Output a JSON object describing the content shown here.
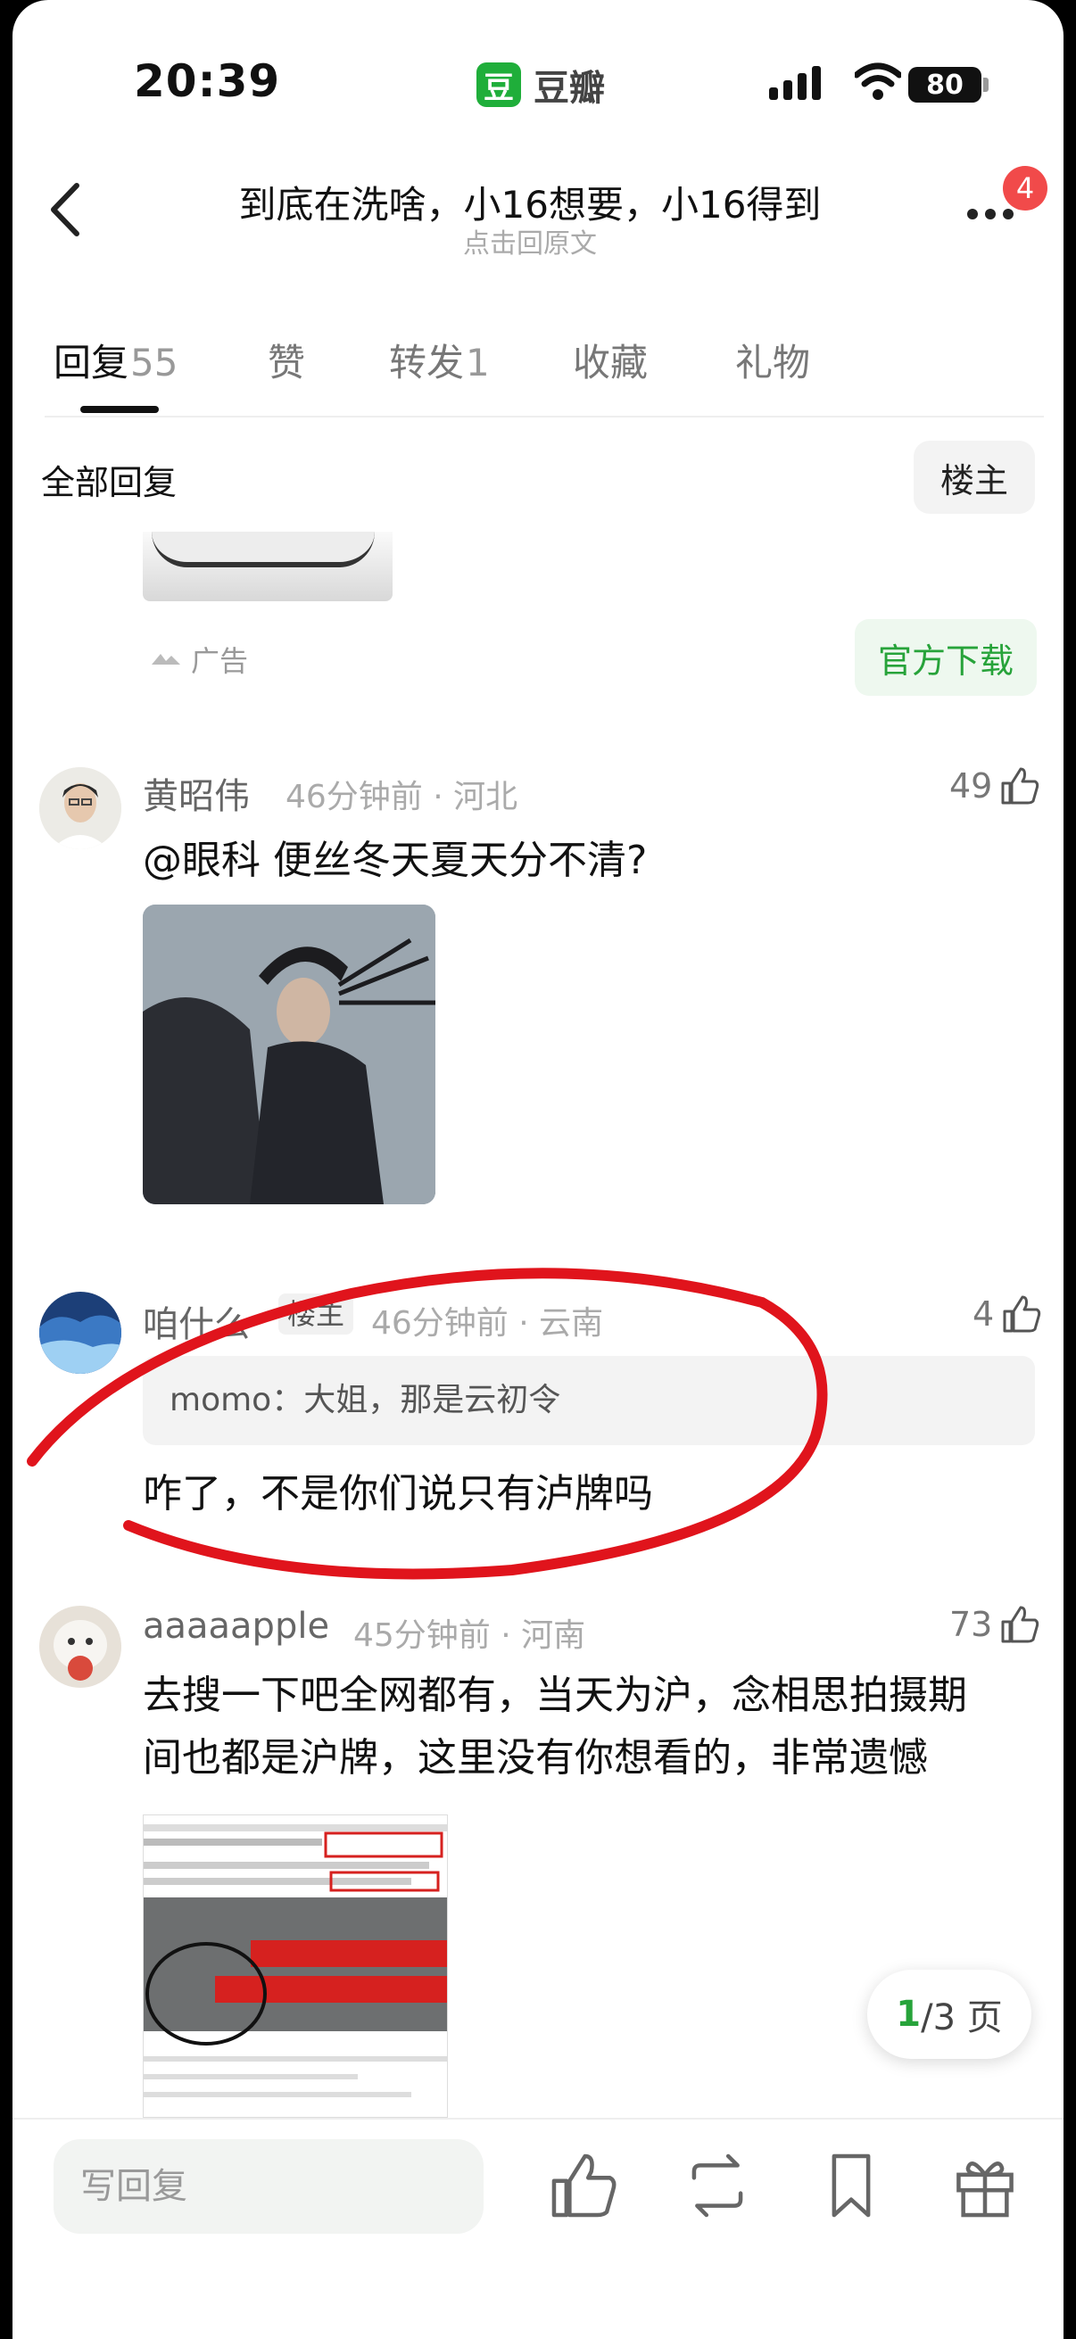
{
  "status": {
    "time": "20:39",
    "app_name": "豆瓣",
    "app_logo": "豆",
    "battery": "80"
  },
  "header": {
    "title": "到底在洗啥，小16想要，小16得到",
    "subtitle": "点击回原文",
    "notification_count": "4"
  },
  "tabs": [
    {
      "label": "回复",
      "count": "55"
    },
    {
      "label": "赞"
    },
    {
      "label": "转发",
      "count": "1"
    },
    {
      "label": "收藏"
    },
    {
      "label": "礼物"
    }
  ],
  "filter": {
    "all_replies": "全部回复",
    "owner_only": "楼主"
  },
  "ad": {
    "label": "广告",
    "download": "官方下载"
  },
  "comments": [
    {
      "user": "黄昭伟",
      "time": "46分钟前",
      "location": "河北",
      "likes": "49",
      "text": "@眼科  便丝冬天夏天分不清?"
    },
    {
      "user": "咱什么",
      "tag": "楼主",
      "time": "46分钟前",
      "location": "云南",
      "likes": "4",
      "quote": "momo：大姐，那是云初令",
      "text": "咋了，不是你们说只有泸牌吗"
    },
    {
      "user": "aaaaapple",
      "time": "45分钟前",
      "location": "河南",
      "likes": "73",
      "text_line1": "去搜一下吧全网都有，当天为沪，念相思拍摄期",
      "text_line2": "间也都是沪牌，这里没有你想看的，非常遗憾"
    }
  ],
  "pager": {
    "current": "1",
    "total": "/3 页"
  },
  "bottom": {
    "reply_placeholder": "写回复"
  },
  "colors": {
    "accent": "#27a33a",
    "badge": "#f14a4a",
    "annotation": "#e0141c"
  }
}
